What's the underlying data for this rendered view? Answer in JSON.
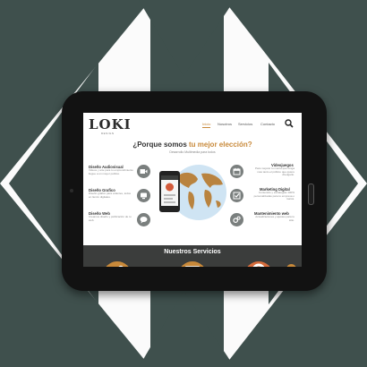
{
  "nav": {
    "logo": "LOKI",
    "logo_sub": "DESIGN",
    "items": [
      "Inicio",
      "Nosotros",
      "Servicios",
      "Contacto"
    ]
  },
  "hero": {
    "title_prefix": "¿Porque somos ",
    "title_accent": "tu mejor elección?",
    "subtitle": "Desarrollo Multimedia para todos"
  },
  "services_left": [
    {
      "title": "Diseño Audiovisual",
      "desc": "Videos y arte para tu emprendimiento llegue a un mayor publico."
    },
    {
      "title": "Diseño Grafico",
      "desc": "Diseño gráfico para volantes, todos en lienzo digitales."
    },
    {
      "title": "Diseño Web",
      "desc": "Creamos diseño y publicación de tu web."
    }
  ],
  "services_right": [
    {
      "title": "Videojuegos",
      "desc": "Para mejorar tu marca que tenga mas tanto el público que quiere divulgarlo."
    },
    {
      "title": "Marketing Digital",
      "desc": "Contenido y estrategias 100% personalizadas para tu empresa o marca."
    },
    {
      "title": "Mantenimiento web",
      "desc": "Actualizaciones y ajustes para tu sitio."
    }
  ],
  "services_band": {
    "title": "Nuestros Servicios"
  },
  "colors": {
    "background": "#3f504d",
    "accent": "#c8893a",
    "band": "#3b3d3c",
    "tablet_frame": "#121212"
  }
}
